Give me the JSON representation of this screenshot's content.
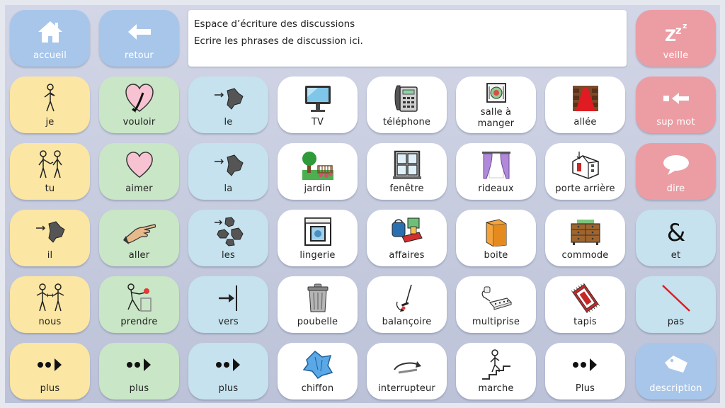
{
  "editor": {
    "heading": "Espace d’écriture des discussions",
    "text": "Ecrire les phrases de discussion ici."
  },
  "top": {
    "home": "accueil",
    "back": "retour",
    "sleep": "veille"
  },
  "right": {
    "delete_word": "sup mot",
    "speak": "dire",
    "and": "et",
    "not": "pas",
    "description": "description"
  },
  "grid": {
    "col1": [
      "je",
      "tu",
      "il",
      "nous",
      "plus"
    ],
    "col2": [
      "vouloir",
      "aimer",
      "aller",
      "prendre",
      "plus"
    ],
    "col3": [
      "le",
      "la",
      "les",
      "vers",
      "plus"
    ],
    "col4": [
      "TV",
      "jardin",
      "lingerie",
      "poubelle",
      "chiffon"
    ],
    "col5": [
      "téléphone",
      "fenêtre",
      "affaires",
      "balançoire",
      "interrupteur"
    ],
    "col6": [
      "salle à",
      "manger",
      "rideaux",
      "boite",
      "multiprise",
      "marche"
    ],
    "col7": [
      "allée",
      "porte arrière",
      "commode",
      "tapis",
      "Plus"
    ]
  },
  "colors": {
    "yellow": "#fbe6a4",
    "green": "#c9e6c6",
    "blue": "#c5e2ee",
    "nav": "#a8c6ea",
    "red": "#ec9da3",
    "heart": "#f7c3d3"
  }
}
